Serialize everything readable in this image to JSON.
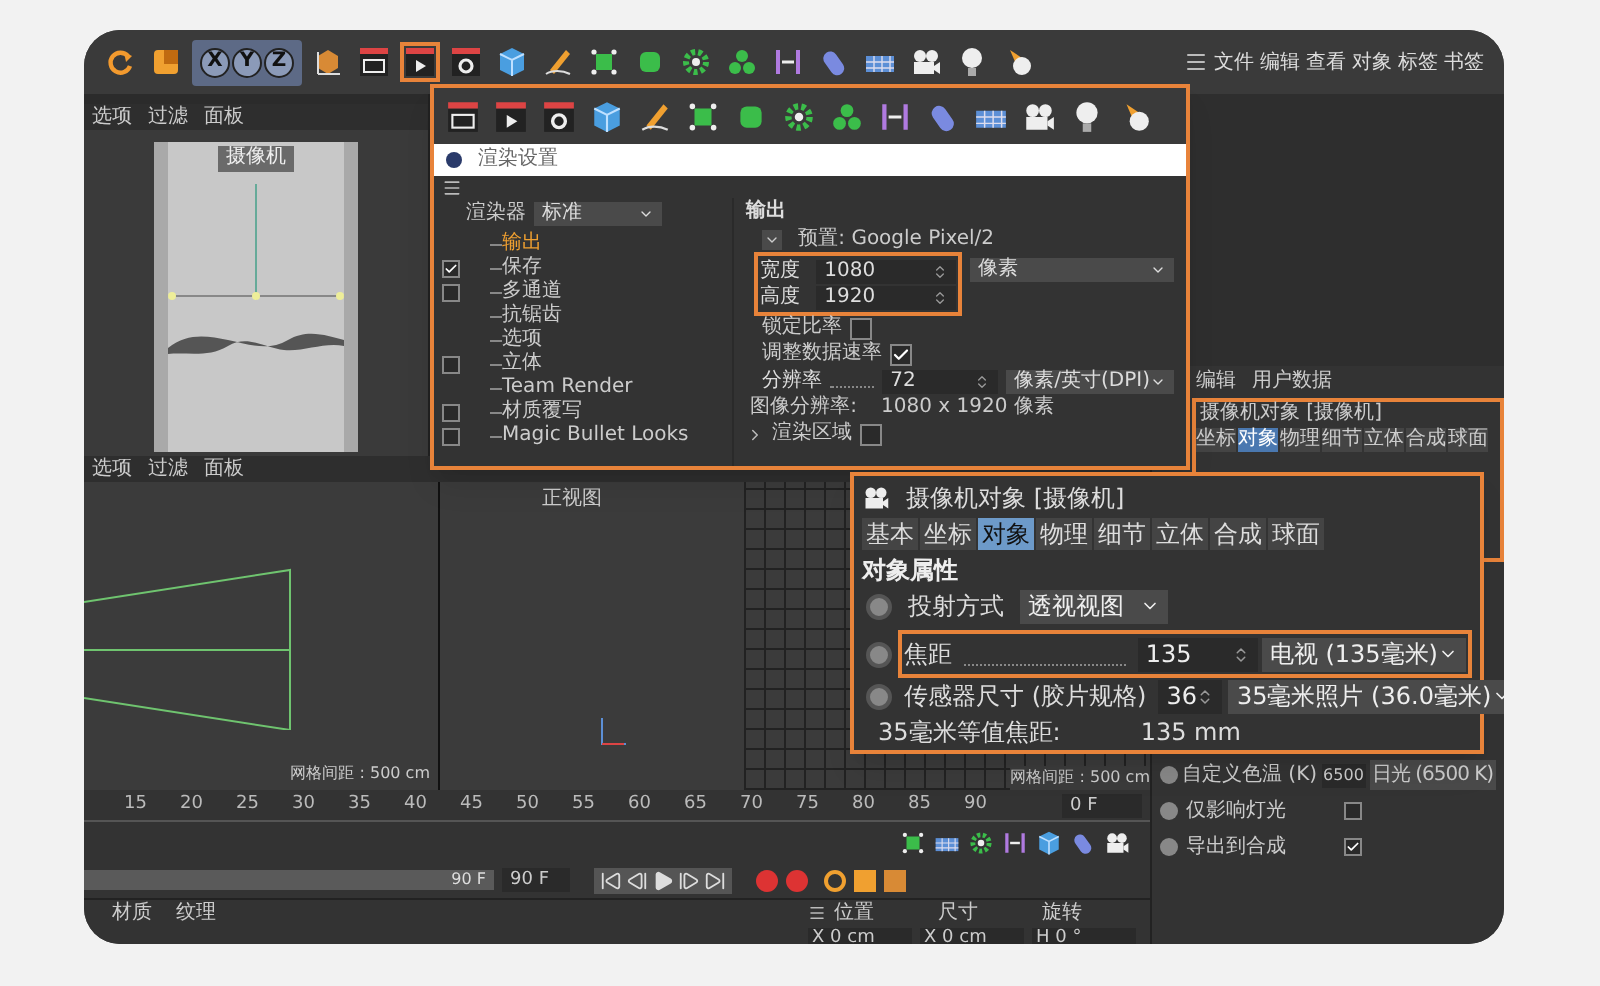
{
  "toolbar": {
    "tools": [
      {
        "kind": "undo",
        "highlighted": false
      },
      {
        "kind": "scale",
        "highlighted": false
      },
      {
        "kind": "axes",
        "highlighted": false
      },
      {
        "kind": "coords",
        "highlighted": false
      },
      {
        "kind": "render-view",
        "highlighted": false
      },
      {
        "kind": "render",
        "highlighted": true
      },
      {
        "kind": "render-settings",
        "highlighted": false
      },
      {
        "kind": "cube",
        "highlighted": false
      },
      {
        "kind": "pen",
        "highlighted": false
      },
      {
        "kind": "subdivision",
        "highlighted": false
      },
      {
        "kind": "rounded-cube",
        "highlighted": false
      },
      {
        "kind": "gear",
        "highlighted": false
      },
      {
        "kind": "cloner",
        "highlighted": false
      },
      {
        "kind": "deformer",
        "highlighted": false
      },
      {
        "kind": "plane",
        "highlighted": false
      },
      {
        "kind": "floor",
        "highlighted": false
      },
      {
        "kind": "camera",
        "highlighted": false
      },
      {
        "kind": "light",
        "highlighted": false
      },
      {
        "kind": "spot",
        "highlighted": false
      }
    ],
    "axis_buttons": [
      "X",
      "Y",
      "Z"
    ],
    "menu": [
      "文件",
      "编辑",
      "查看",
      "对象",
      "标签",
      "书签"
    ]
  },
  "viewport_top": {
    "menu": [
      "选项",
      "过滤",
      "面板"
    ],
    "camera_label": "摄像机"
  },
  "viewport_bottom": {
    "menu": [
      "选项",
      "过滤",
      "面板"
    ],
    "view_label": "正视图",
    "grid_labels": [
      "网格间距 : 500 cm",
      "网格间距 : 500 cm"
    ]
  },
  "timeline": {
    "ticks": [
      "15",
      "20",
      "25",
      "30",
      "35",
      "40",
      "45",
      "50",
      "55",
      "60",
      "65",
      "70",
      "75",
      "80",
      "85",
      "90"
    ],
    "current_frame": "0 F",
    "end_marker": "90 F",
    "end_field": "90 F"
  },
  "materials": {
    "menu": [
      "材质",
      "纹理"
    ]
  },
  "coordinates": {
    "headers": [
      "位置",
      "尺寸",
      "旋转"
    ],
    "fields": [
      {
        "axis": "X",
        "value": "0 cm"
      },
      {
        "axis": "X",
        "value": "0 cm"
      },
      {
        "axis": "H",
        "value": "0 °"
      }
    ]
  },
  "attributes": {
    "tabs": [
      "编辑",
      "用户数据"
    ],
    "mini_title": "摄像机对象 [摄像机]",
    "mini_tabs": [
      {
        "label": "坐标",
        "selected": false
      },
      {
        "label": "对象",
        "selected": true
      },
      {
        "label": "物理",
        "selected": false
      },
      {
        "label": "细节",
        "selected": false
      },
      {
        "label": "立体",
        "selected": false
      },
      {
        "label": "合成",
        "selected": false
      },
      {
        "label": "球面",
        "selected": false
      }
    ],
    "rows": [
      {
        "kind": "field",
        "label": "自定义色温 (K)",
        "value": "6500",
        "preset": "日光 (6500 K)"
      },
      {
        "kind": "check",
        "label": "仅影响灯光",
        "checked": false
      },
      {
        "kind": "check",
        "label": "导出到合成",
        "checked": true
      }
    ]
  },
  "render_settings": {
    "tools": [
      {
        "kind": "render-view"
      },
      {
        "kind": "render"
      },
      {
        "kind": "render-settings"
      },
      {
        "kind": "cube"
      },
      {
        "kind": "pen"
      },
      {
        "kind": "subdivision"
      },
      {
        "kind": "rounded-cube"
      },
      {
        "kind": "gear"
      },
      {
        "kind": "cloner"
      },
      {
        "kind": "deformer"
      },
      {
        "kind": "plane"
      },
      {
        "kind": "floor"
      },
      {
        "kind": "camera"
      },
      {
        "kind": "light"
      },
      {
        "kind": "spot"
      }
    ],
    "title": "渲染设置",
    "renderer": {
      "label": "渲染器",
      "value": "标准"
    },
    "tree": [
      {
        "label": "输出",
        "kind": "plain",
        "selected": true
      },
      {
        "label": "保存",
        "kind": "check",
        "checked": true,
        "selected": false
      },
      {
        "label": "多通道",
        "kind": "check",
        "checked": false,
        "selected": false
      },
      {
        "label": "抗锯齿",
        "kind": "plain",
        "selected": false
      },
      {
        "label": "选项",
        "kind": "plain",
        "selected": false
      },
      {
        "label": "立体",
        "kind": "check",
        "checked": false,
        "selected": false
      },
      {
        "label": "Team Render",
        "kind": "plain",
        "selected": false
      },
      {
        "label": "材质覆写",
        "kind": "check",
        "checked": false,
        "selected": false
      },
      {
        "label": "Magic Bullet Looks",
        "kind": "check",
        "checked": false,
        "selected": false
      }
    ],
    "heading": "输出",
    "preset": "预置: Google Pixel/2",
    "size": {
      "highlighted": true,
      "width": {
        "label": "宽度",
        "value": "1080",
        "unit": "像素"
      },
      "height": {
        "label": "高度",
        "value": "1920"
      }
    },
    "options": [
      {
        "kind": "check",
        "label": "锁定比率",
        "checked": false
      },
      {
        "kind": "check",
        "label": "调整数据速率",
        "checked": true
      },
      {
        "kind": "number",
        "label": "分辨率",
        "value": "72",
        "unit": "像素/英寸(DPI)"
      },
      {
        "kind": "info",
        "label": "图像分辨率:",
        "value": "1080 x 1920 像素"
      },
      {
        "kind": "expand",
        "label": "渲染区域",
        "checked": false
      }
    ]
  },
  "camera_object": {
    "title": "摄像机对象 [摄像机]",
    "tabs": [
      {
        "label": "基本",
        "selected": false
      },
      {
        "label": "坐标",
        "selected": false
      },
      {
        "label": "对象",
        "selected": true
      },
      {
        "label": "物理",
        "selected": false
      },
      {
        "label": "细节",
        "selected": false
      },
      {
        "label": "立体",
        "selected": false
      },
      {
        "label": "合成",
        "selected": false
      },
      {
        "label": "球面",
        "selected": false
      }
    ],
    "section": "对象属性",
    "projection": {
      "label": "投射方式",
      "value": "透视视图"
    },
    "focal": {
      "label": "焦距",
      "value": "135",
      "preset": "电视 (135毫米)",
      "highlighted": true
    },
    "sensor": {
      "label": "传感器尺寸 (胶片规格)",
      "value": "36",
      "preset": "35毫米照片 (36.0毫米)"
    },
    "equivalent": {
      "label": "35毫米等值焦距:",
      "value": "135 mm"
    }
  }
}
